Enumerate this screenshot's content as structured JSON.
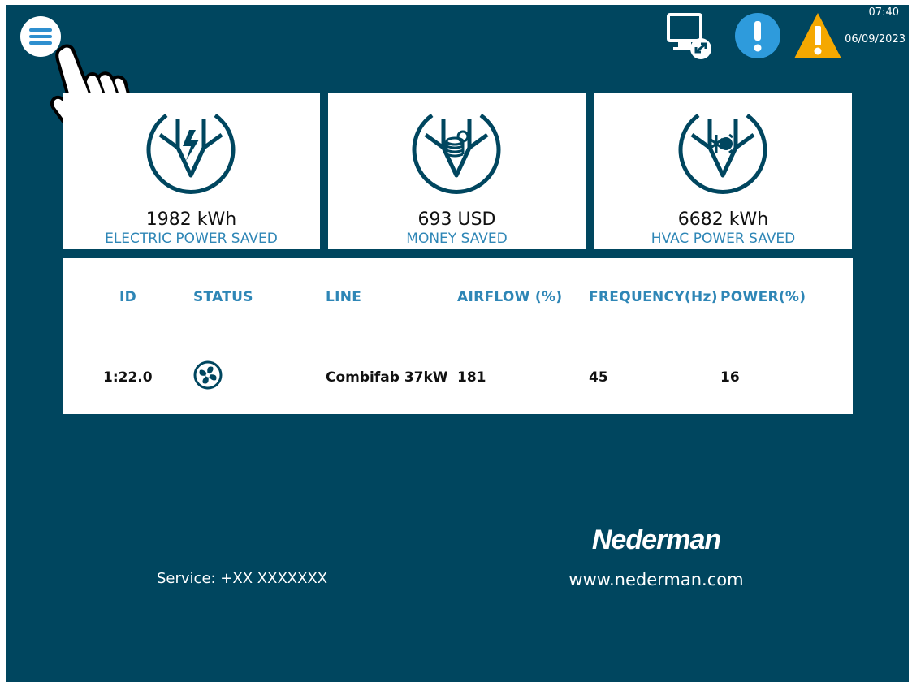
{
  "header": {
    "time": "07:40",
    "date": "06/09/2023"
  },
  "cards": [
    {
      "value": "1982 kWh",
      "label": "ELECTRIC POWER SAVED",
      "icon": "lightning-arrow-icon"
    },
    {
      "value": "693 USD",
      "label": "MONEY SAVED",
      "icon": "coins-arrow-icon"
    },
    {
      "value": "6682 kWh",
      "label": "HVAC POWER SAVED",
      "icon": "hvac-arrow-icon"
    }
  ],
  "table": {
    "headers": {
      "id": "ID",
      "status": "STATUS",
      "line": "LINE",
      "airflow": "AIRFLOW (%)",
      "frequency": "FREQUENCY(Hz)",
      "power": "POWER(%)"
    },
    "rows": [
      {
        "id": "1:22.0",
        "status_icon": "fan-icon",
        "line": "Combifab 37kW",
        "airflow": "181",
        "frequency": "45",
        "power": "16"
      }
    ]
  },
  "footer": {
    "service": "Service: +XX XXXXXXX",
    "brand": "Nederman",
    "website": "www.nederman.com"
  },
  "colors": {
    "background": "#00465f",
    "accent": "#2e86b6",
    "info": "#2e9bdc",
    "warning": "#f5a800"
  }
}
